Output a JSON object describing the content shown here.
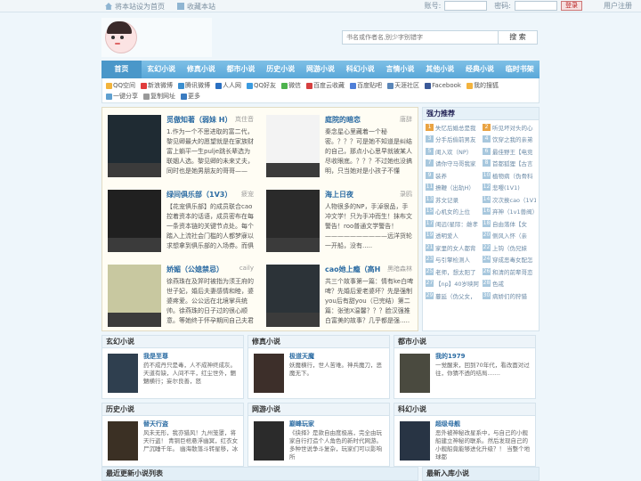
{
  "topbar": {
    "links": [
      "将本站设为首页",
      "收藏本站"
    ],
    "account_label": "账号:",
    "password_label": "密码:",
    "login_button": "登录",
    "register": "用户注册"
  },
  "search": {
    "placeholder": "书名或作者名,别少字别错字",
    "button": "搜 索"
  },
  "nav": [
    "首页",
    "玄幻小说",
    "修真小说",
    "都市小说",
    "历史小说",
    "网游小说",
    "科幻小说",
    "言情小说",
    "其他小说",
    "经典小说",
    "临时书架"
  ],
  "share": [
    {
      "label": "QQ空间",
      "color": "#f2b43c"
    },
    {
      "label": "新浪微博",
      "color": "#e03c3c"
    },
    {
      "label": "腾讯微博",
      "color": "#3b8fd0"
    },
    {
      "label": "人人网",
      "color": "#2a6fc1"
    },
    {
      "label": "QQ好友",
      "color": "#3a9be0"
    },
    {
      "label": "微信",
      "color": "#4db34d"
    },
    {
      "label": "百度云收藏",
      "color": "#d64040"
    },
    {
      "label": "百度贴吧",
      "color": "#4f7fd8"
    },
    {
      "label": "天涯社区",
      "color": "#5a86b8"
    },
    {
      "label": "Facebook",
      "color": "#3b5998"
    },
    {
      "label": "我的搜狐",
      "color": "#f3b33d"
    },
    {
      "label": "一键分享",
      "color": "#5fa0d0"
    },
    {
      "label": "复制网址",
      "color": "#999999"
    },
    {
      "label": "更多",
      "color": "#3a7bc0"
    }
  ],
  "featured": [
    {
      "title": "觅傲知著（弱妹 H）",
      "author": "岚住音",
      "desc": "1.作为一个不思进取的富二代，黎见卿最大的愿望就是在家族财富上躺平一生pulje跳长辈选为联姻人选。黎见卿的未来丈夫，同时也是她男朋友的哥哥——郝..."
    },
    {
      "title": "庭院的暗恋",
      "author": "唐辞",
      "desc": "秦念星心里藏着一个秘密。？？？可是她不知道是纠结的自己，那点小心思早就被某人尽收眼底。？？？不过她也没搞明，只当她对是小孩子不懂事。？？..."
    },
    {
      "title": "绿间俱乐部（1V3）",
      "author": "疲宠",
      "desc": "【花宠俱乐部】的成员联合cao控着资本的话语，成员密布在每一条资本链的关键节点处。每个踏入上流社会门槛的人都梦寐以求想拿到俱乐部的入场券。而俱乐..."
    },
    {
      "title": "海上日夜",
      "author": "录鸥",
      "desc": "人物很多的NP，手淖很品，手冲文学！只为手冲而生！抹布文警告！roo普通文学警告！——————————远洋货轮一开船，没有....."
    },
    {
      "title": "娇媚（公媳禁忌）",
      "author": "caily",
      "desc": "徐燕珠在及笄时被指为须王府的世子妃，婚后夫妻感情和睦，婆婆疼爱。公公远在北境掌兵统帅。徐燕珠的日子过的很心顺意。等她终于怀孕期间自己夫君和表妹拉..."
    },
    {
      "title": "cao她上瘾（高H",
      "author": "黑暗森林",
      "desc": "共三个故事第一篇：情有ke白啤啤？先婚后爱老婆坏？先是强制you后有甜you（已完结）第二篇：张弛X温馨？？？脸汉强推白富美的故事？几乎都是强....."
    }
  ],
  "recommend": {
    "title": "强力推荐",
    "items": [
      "失忆后婚总是我",
      "听见坏对头的心",
      "分手后偷前男友",
      "饮穿之我的亲弟",
      "闺入欢（NP）",
      "最佳野王【电竞",
      "请你守马哥我家",
      "首都狐狸【古言",
      "装养",
      "植物病（伪骨科",
      "撩鞭（出轨H）",
      "悲嘤(1V1)",
      "苏文记录",
      "次次挨cao（1V1",
      "心机女的上位",
      "弃神（1v1兽阀）",
      "闺远(星际：雌孝",
      "自由落体【女",
      "透明爱人",
      "侧风入怀（亲",
      "家里的女人都背",
      "上钩（伪兄妹",
      "与引擎检测人",
      "穿成恶毒女配怎",
      "老师，想太阳了",
      "和清的前辈哥恋",
      "【np】40岁映阿",
      "色戒",
      "蔓延（伪父女，",
      "病娇们的狩猎"
    ]
  },
  "categories": [
    {
      "name": "玄幻小说",
      "book": "我是至尊",
      "desc": "药不成丹只是毒，人不成神终成灰。 天道有缺，人间不平，红尘世外，魍魉横行；妄尔良善，怒"
    },
    {
      "name": "修真小说",
      "book": "极道天魔",
      "desc": "妖魔横行，世人苦难。神兵魔刀，恶魔无下。"
    },
    {
      "name": "都市小说",
      "book": "我的1979",
      "desc": "一觉醒来，回到70年代，看改面对过往，你猜不透的结局......."
    },
    {
      "name": "历史小说",
      "book": "替天行盗",
      "desc": "风未无形，我亦猎风！九州笼罩，将天行盗！ 青铜巨棺悬浮幽冥，红衣女尸沉睡千年。 幽海散落斗转星移，冰"
    },
    {
      "name": "网游小说",
      "book": "巅峰玩家",
      "desc": "《抉择》是款自由度极高，完全由玩家自行打造个人角色的新时代网游。多种世说争斗复杂，玩家们可以影响所"
    },
    {
      "name": "科幻小说",
      "book": "超级母舰",
      "desc": "恶外被神秘改星系中，与自己的小舰船建立神秘的联系。然后发现自己的小舰船竟能够进化升级？！ 当整个地球都"
    }
  ],
  "bottom": {
    "left": "最近更新小说列表",
    "right": "最新入库小说"
  }
}
